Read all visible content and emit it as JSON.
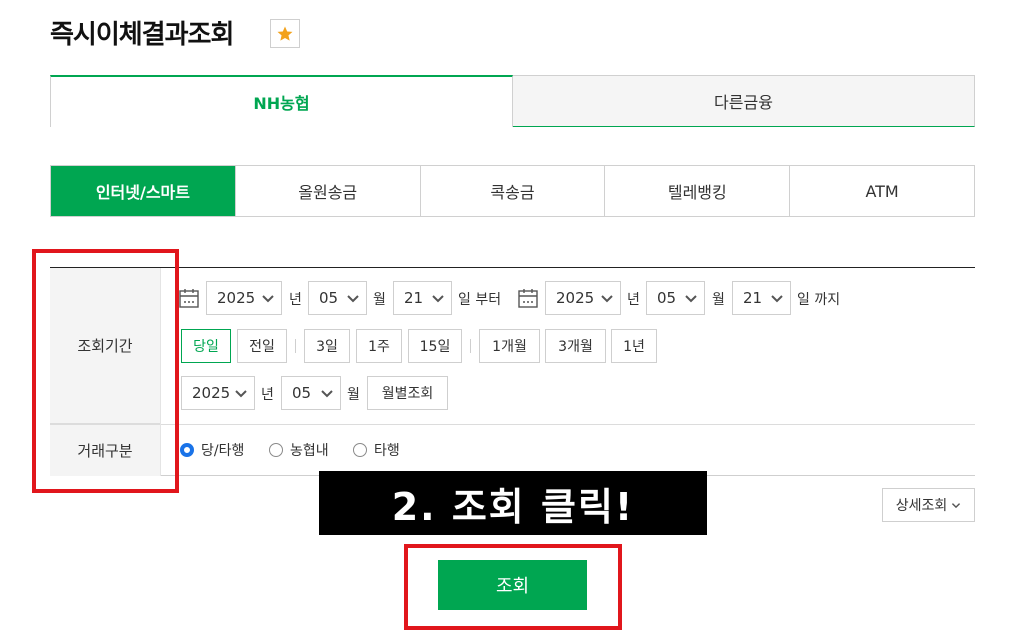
{
  "page": {
    "title": "즉시이체결과조회",
    "favorite_icon": "star-icon",
    "accent": "#00a651"
  },
  "top_tabs": [
    {
      "label": "NH농협",
      "active": true
    },
    {
      "label": "다른금융",
      "active": false
    }
  ],
  "sub_tabs": [
    {
      "label": "인터넷/스마트",
      "active": true
    },
    {
      "label": "올원송금"
    },
    {
      "label": "콕송금"
    },
    {
      "label": "텔레뱅킹"
    },
    {
      "label": "ATM"
    }
  ],
  "form": {
    "period_label": "조회기간",
    "type_label": "거래구분",
    "start": {
      "year": "2025",
      "month": "05",
      "day": "21"
    },
    "end": {
      "year": "2025",
      "month": "05",
      "day": "21"
    },
    "unit_year": "년",
    "unit_month": "월",
    "unit_day_from": "일 부터",
    "unit_day_to": "일 까지",
    "quick_buttons": [
      "당일",
      "전일",
      "3일",
      "1주",
      "15일",
      "1개월",
      "3개월",
      "1년"
    ],
    "monthly": {
      "year": "2025",
      "month": "05",
      "button": "월별조회"
    },
    "radio_options": [
      {
        "label": "당/타행",
        "checked": true
      },
      {
        "label": "농협내",
        "checked": false
      },
      {
        "label": "타행",
        "checked": false
      }
    ]
  },
  "annotation": {
    "banner": "2. 조회 클릭!",
    "highlight_color": "#e1161c"
  },
  "detail_button": "상세조회",
  "submit_button": "조회"
}
